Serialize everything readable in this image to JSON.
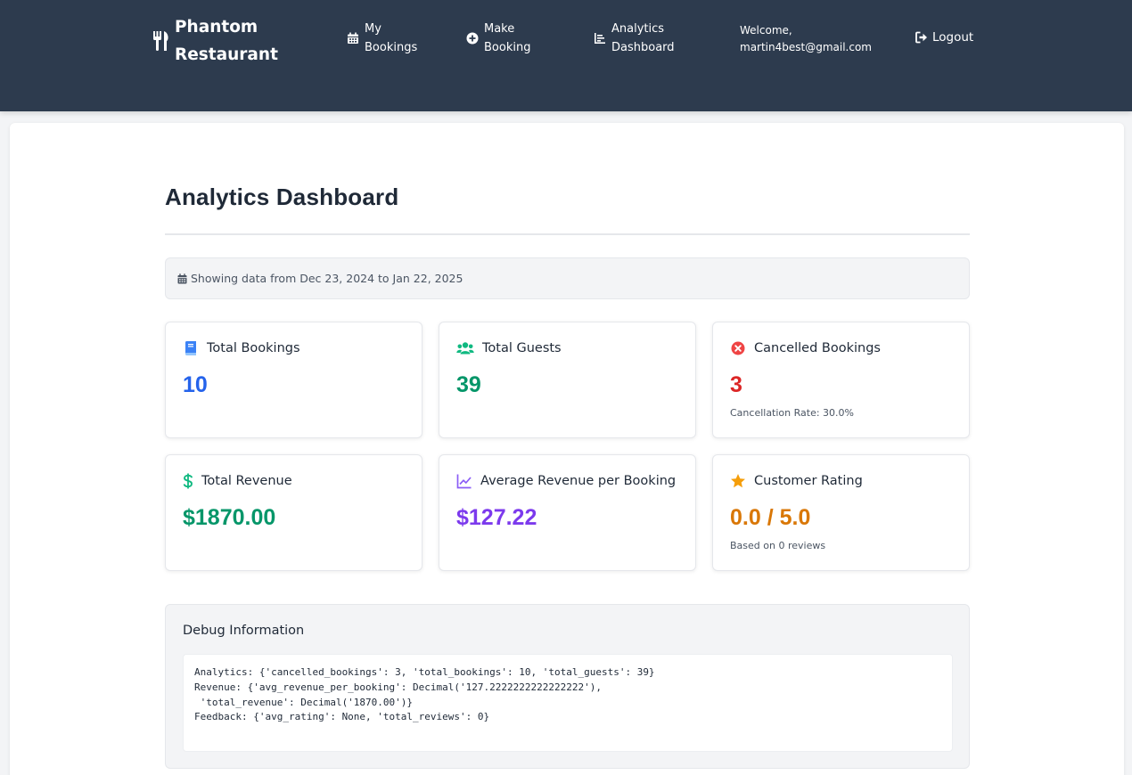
{
  "header": {
    "brand_line1": "Phantom",
    "brand_line2": "Restaurant",
    "nav": [
      {
        "line1": "My",
        "line2": "Bookings",
        "icon": "calendar-icon"
      },
      {
        "line1": "Make",
        "line2": "Booking",
        "icon": "plus-circle-icon"
      },
      {
        "line1": "Analytics",
        "line2": "Dashboard",
        "icon": "bar-chart-icon"
      }
    ],
    "welcome_line1": "Welcome,",
    "welcome_line2": "martin4best@gmail.com",
    "logout_label": "Logout",
    "background": "#2d3b4e"
  },
  "page": {
    "title": "Analytics Dashboard",
    "date_range_text": "Showing data from Dec 23, 2024 to Jan 22, 2025"
  },
  "cards": [
    {
      "label": "Total Bookings",
      "value": "10",
      "note": "",
      "icon": "book-icon",
      "color": "#2563eb"
    },
    {
      "label": "Total Guests",
      "value": "39",
      "note": "",
      "icon": "users-icon",
      "color": "#059669"
    },
    {
      "label": "Cancelled Bookings",
      "value": "3",
      "note": "Cancellation Rate: 30.0%",
      "icon": "x-circle-icon",
      "color": "#dc2626"
    },
    {
      "label": "Total Revenue",
      "value": "$1870.00",
      "note": "",
      "icon": "dollar-icon",
      "color": "#059669"
    },
    {
      "label": "Average Revenue per Booking",
      "value": "$127.22",
      "note": "",
      "icon": "line-chart-icon",
      "color": "#7c3aed"
    },
    {
      "label": "Customer Rating",
      "value": "0.0 / 5.0",
      "note": "Based on 0 reviews",
      "icon": "star-icon",
      "color": "#d97706"
    }
  ],
  "debug": {
    "title": "Debug Information",
    "lines": [
      "Analytics: {'cancelled_bookings': 3, 'total_bookings': 10, 'total_guests': 39}",
      "Revenue: {'avg_revenue_per_booking': Decimal('127.2222222222222222'),",
      " 'total_revenue': Decimal('1870.00')}",
      "Feedback: {'avg_rating': None, 'total_reviews': 0}"
    ]
  }
}
